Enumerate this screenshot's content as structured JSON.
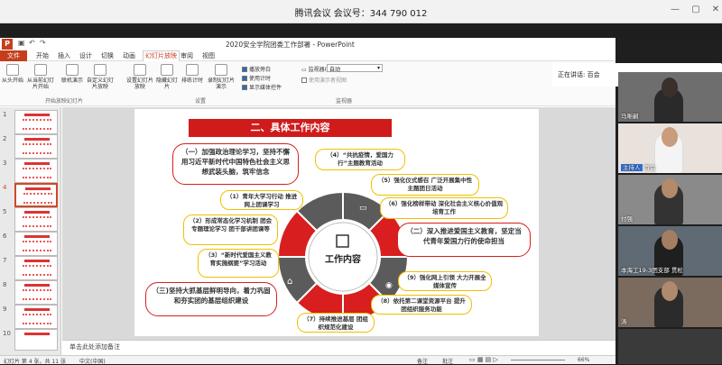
{
  "meeting": {
    "title": "腾讯会议 会议号：344 790 012"
  },
  "window_controls": [
    "—",
    "▢",
    "✕"
  ],
  "app": {
    "document_title": "2020安全学院团委工作部署 - PowerPoint",
    "login": "登录"
  },
  "tabs": [
    "文件",
    "开始",
    "插入",
    "设计",
    "切换",
    "动画",
    "幻灯片放映",
    "审阅",
    "视图"
  ],
  "active_tab": "幻灯片放映",
  "ribbon": {
    "buttons": [
      "从头开始",
      "从当前幻灯片开始",
      "联机演示",
      "自定义幻灯片放映",
      "设置幻灯片放映",
      "隐藏幻灯片",
      "排练计时",
      "录制幻灯片演示"
    ],
    "checks": [
      {
        "label": "播放旁白",
        "on": true
      },
      {
        "label": "使用计时",
        "on": true
      },
      {
        "label": "显示媒体控件",
        "on": true
      }
    ],
    "monitor_label": "监视器(O):",
    "monitor_value": "自动",
    "presenter_view": "使用演示者视图",
    "groups": [
      "开始放映幻灯片",
      "设置",
      "监视器"
    ]
  },
  "thumbnails": {
    "numbers": [
      "1",
      "2",
      "3",
      "4",
      "5",
      "6",
      "7",
      "8",
      "9",
      "10"
    ],
    "selected": 4
  },
  "slide": {
    "title": "二、具体工作内容",
    "center": "工作内容",
    "items": [
      "（一）加强政治理论学习，坚持不懈用习近平新时代中国特色社会主义思想武装头脑，筑牢信念",
      "（4）“共抗疫情，爱国力行”主题教育活动",
      "（5）强化仪式感召 广泛开展集中性主题团日活动",
      "（6）强化榜样带动 深化社会主义核心价值观培育工作",
      "（1）青年大学习行动 推进网上团课学习",
      "（2）形成常态化学习机制 团会专题理论学习 团干部讲团课等",
      "（3）“新时代爱国主义教育实施纲要”学习活动",
      "（二）深入推进爱国主义教育，坚定当代青年爱国力行的使命担当",
      "（9）强化网上引领 大力开展全媒体宣传",
      "（8）依托第二课堂资源平台 提升团组织服务功能",
      "（三)坚持大抓基层鲜明导向，着力巩固和夯实团的基层组织建设",
      "（7）持续推进基层 团组织规范化建设"
    ]
  },
  "notes_placeholder": "单击此处添加备注",
  "status": {
    "slide_info": "幻灯片 第 4 张，共 11 张",
    "language": "中文(中国)",
    "notes": "备注",
    "comments": "批注",
    "zoom": "66%"
  },
  "participants": {
    "speaking": "正在讲话: 百会",
    "list": [
      {
        "name": "马晰嗣",
        "host": false
      },
      {
        "name": "百会",
        "host": true,
        "host_label": "主持人"
      },
      {
        "name": "付强",
        "host": false
      },
      {
        "name": "本海工19-3团支部 贯松",
        "host": false
      },
      {
        "name": "涛",
        "host": false
      }
    ]
  },
  "colors": {
    "accent": "#c43e1c",
    "slide_red": "#d01b1b",
    "yellow": "#f0c000"
  }
}
